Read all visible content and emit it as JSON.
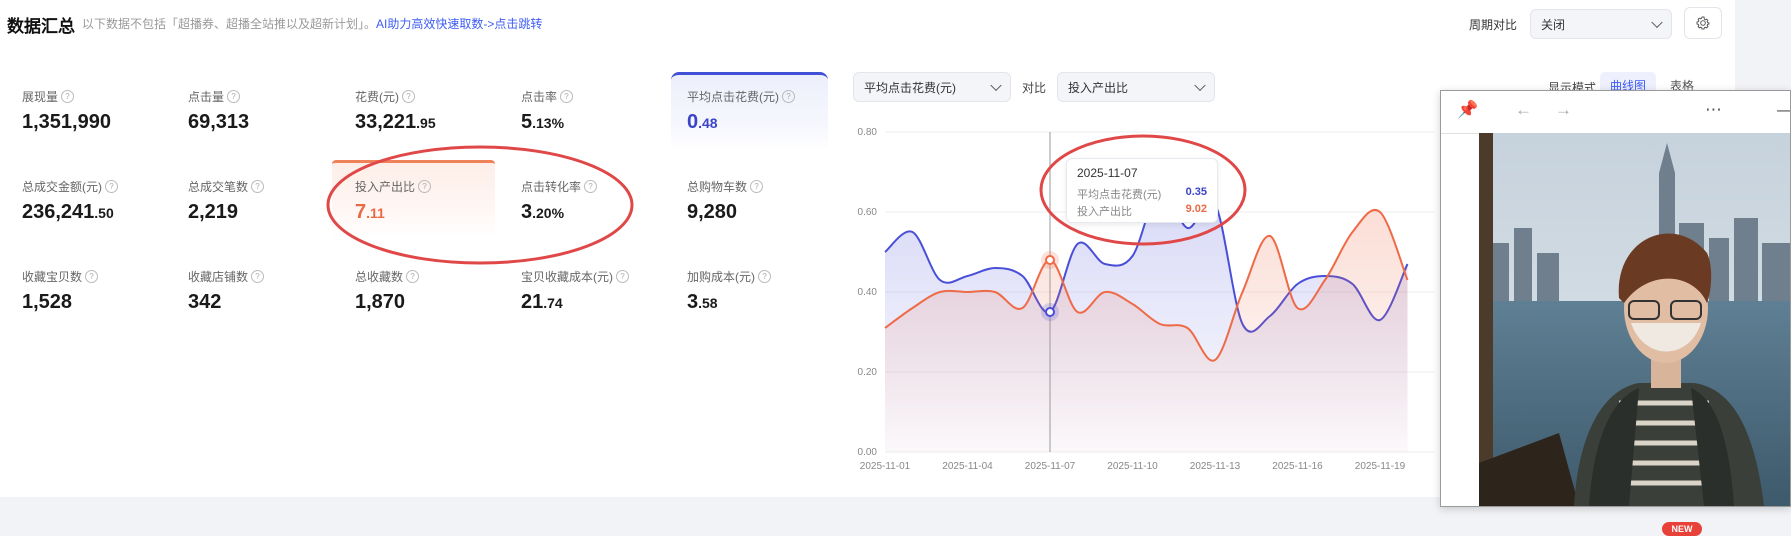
{
  "header": {
    "title": "数据汇总",
    "note": "以下数据不包括「超播券、超播全站推以及超新计划」。",
    "link": "AI助力高效快速取数->点击跳转",
    "period_label": "周期对比",
    "period_value": "关闭"
  },
  "metrics": [
    {
      "label": "展现量",
      "int": "1,351,990",
      "dec": ""
    },
    {
      "label": "点击量",
      "int": "69,313",
      "dec": ""
    },
    {
      "label": "花费(元)",
      "int": "33,221",
      "dec": ".95"
    },
    {
      "label": "点击率",
      "int": "5",
      "dec": ".13%"
    },
    {
      "label": "平均点击花费(元)",
      "int": "0",
      "dec": ".48"
    },
    {
      "label": "总成交金额(元)",
      "int": "236,241",
      "dec": ".50"
    },
    {
      "label": "总成交笔数",
      "int": "2,219",
      "dec": ""
    },
    {
      "label": "投入产出比",
      "int": "7",
      "dec": ".11"
    },
    {
      "label": "点击转化率",
      "int": "3",
      "dec": ".20%"
    },
    {
      "label": "总购物车数",
      "int": "9,280",
      "dec": ""
    },
    {
      "label": "收藏宝贝数",
      "int": "1,528",
      "dec": ""
    },
    {
      "label": "收藏店铺数",
      "int": "342",
      "dec": ""
    },
    {
      "label": "总收藏数",
      "int": "1,870",
      "dec": ""
    },
    {
      "label": "宝贝收藏成本(元)",
      "int": "21",
      "dec": ".74"
    },
    {
      "label": "加购成本(元)",
      "int": "3",
      "dec": ".58"
    }
  ],
  "controls": {
    "primary_metric": "平均点击花费(元)",
    "compare_label": "对比",
    "compare_metric": "投入产出比",
    "mode_label": "显示模式",
    "mode_curve": "曲线图",
    "mode_table": "表格"
  },
  "colors": {
    "series_blue": "#4a4fd8",
    "series_orange": "#ef6a47",
    "accent_link": "#3d5cf5",
    "annotation_red": "#e04848"
  },
  "chart_data": {
    "type": "line",
    "x": [
      "2025-11-01",
      "2025-11-02",
      "2025-11-03",
      "2025-11-04",
      "2025-11-05",
      "2025-11-06",
      "2025-11-07",
      "2025-11-08",
      "2025-11-09",
      "2025-11-10",
      "2025-11-11",
      "2025-11-12",
      "2025-11-13",
      "2025-11-14",
      "2025-11-15",
      "2025-11-16",
      "2025-11-17",
      "2025-11-18",
      "2025-11-19",
      "2025-11-20"
    ],
    "x_tick_labels": [
      "2025-11-01",
      "2025-11-04",
      "2025-11-07",
      "2025-11-10",
      "2025-11-13",
      "2025-11-16",
      "2025-11-19"
    ],
    "y_ticks": [
      "0.80",
      "0.60",
      "0.40",
      "0.20",
      "0.00"
    ],
    "ylim": [
      0,
      0.8
    ],
    "series": [
      {
        "name": "平均点击花费(元)",
        "values": [
          0.5,
          0.55,
          0.43,
          0.44,
          0.46,
          0.44,
          0.35,
          0.52,
          0.47,
          0.49,
          0.66,
          0.56,
          0.62,
          0.32,
          0.34,
          0.42,
          0.44,
          0.42,
          0.33,
          0.47
        ]
      },
      {
        "name": "投入产出比",
        "values": [
          0.31,
          0.36,
          0.4,
          0.4,
          0.4,
          0.36,
          0.48,
          0.35,
          0.4,
          0.37,
          0.32,
          0.31,
          0.23,
          0.4,
          0.54,
          0.36,
          0.43,
          0.55,
          0.6,
          0.43
        ]
      }
    ],
    "tooltip": {
      "date": "2025-11-07",
      "rows": [
        {
          "label": "平均点击花费(元)",
          "value": "0.35"
        },
        {
          "label": "投入产出比",
          "value": "9.02"
        }
      ]
    }
  },
  "popup": {},
  "badge": {
    "text": "NEW"
  }
}
